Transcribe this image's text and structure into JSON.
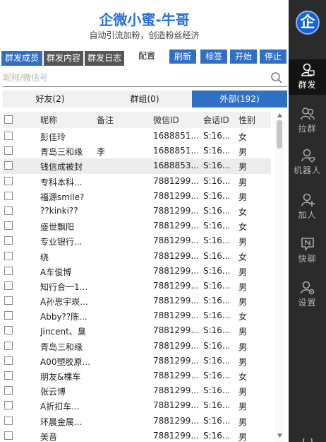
{
  "header": {
    "title": "企微小蜜-牛哥",
    "subtitle": "自动引流加粉，创造粉丝经济"
  },
  "toolbar": {
    "tabs": [
      "群发成员",
      "群发内容",
      "群发日志"
    ],
    "config_label": "配置",
    "buttons": [
      "刷新",
      "标签",
      "开始",
      "停止"
    ]
  },
  "search": {
    "placeholder": "昵称/微信号"
  },
  "segment": [
    "好友(2)",
    "群组(0)",
    "外部(192)"
  ],
  "table": {
    "columns": [
      "昵称",
      "备注",
      "微信ID",
      "会话ID",
      "性别"
    ],
    "rows": [
      {
        "nick": "彭佳玲",
        "remark": "",
        "wxid": "1688851...",
        "sid": "S:16...",
        "sex": "女"
      },
      {
        "nick": "青岛三和缘",
        "remark": "李",
        "wxid": "1688851...",
        "sid": "S:16...",
        "sex": "男"
      },
      {
        "nick": "钱信成被封",
        "remark": "",
        "wxid": "1688853...",
        "sid": "S:16...",
        "sex": "男"
      },
      {
        "nick": "专科本科...",
        "remark": "",
        "wxid": "7881299...",
        "sid": "S:16...",
        "sex": "男"
      },
      {
        "nick": "福源smile?",
        "remark": "",
        "wxid": "7881299...",
        "sid": "S:16...",
        "sex": "男"
      },
      {
        "nick": "??kinki??",
        "remark": "",
        "wxid": "7881299...",
        "sid": "S:16...",
        "sex": "女"
      },
      {
        "nick": "盛世飘阳",
        "remark": "",
        "wxid": "7881299...",
        "sid": "S:16...",
        "sex": "女"
      },
      {
        "nick": "专业银行...",
        "remark": "",
        "wxid": "7881299...",
        "sid": "S:16...",
        "sex": "男"
      },
      {
        "nick": "绕",
        "remark": "",
        "wxid": "7881299...",
        "sid": "S:16...",
        "sex": "女"
      },
      {
        "nick": "A车俊博",
        "remark": "",
        "wxid": "7881299...",
        "sid": "S:16...",
        "sex": "男"
      },
      {
        "nick": "知行合一1...",
        "remark": "",
        "wxid": "7881299...",
        "sid": "S:16...",
        "sex": "男"
      },
      {
        "nick": "A孙思宇崁...",
        "remark": "",
        "wxid": "7881299...",
        "sid": "S:16...",
        "sex": "男"
      },
      {
        "nick": "Abby??陈...",
        "remark": "",
        "wxid": "7881299...",
        "sid": "S:16...",
        "sex": "女"
      },
      {
        "nick": "Jincent、臭",
        "remark": "",
        "wxid": "7881299...",
        "sid": "S:16...",
        "sex": "男"
      },
      {
        "nick": "青岛三和缘",
        "remark": "",
        "wxid": "7881299...",
        "sid": "S:16...",
        "sex": "男"
      },
      {
        "nick": "A00塑胶原...",
        "remark": "",
        "wxid": "7881299...",
        "sid": "S:16...",
        "sex": "男"
      },
      {
        "nick": "朋友&棵车",
        "remark": "",
        "wxid": "7881299...",
        "sid": "S:16...",
        "sex": "女"
      },
      {
        "nick": "张云博",
        "remark": "",
        "wxid": "7881299...",
        "sid": "S:16...",
        "sex": "男"
      },
      {
        "nick": "A折扣车...",
        "remark": "",
        "wxid": "7881299...",
        "sid": "S:16...",
        "sex": "男"
      },
      {
        "nick": "环晨金属...",
        "remark": "",
        "wxid": "7881299...",
        "sid": "S:16...",
        "sex": "男"
      },
      {
        "nick": "美音",
        "remark": "",
        "wxid": "7881299...",
        "sid": "S:16...",
        "sex": "男"
      }
    ]
  },
  "sidebar": {
    "logo": "企",
    "items": [
      {
        "label": "群发",
        "icon": "mass-send-icon"
      },
      {
        "label": "拉群",
        "icon": "group-icon"
      },
      {
        "label": "机器人",
        "icon": "robot-heart-icon"
      },
      {
        "label": "加人",
        "icon": "add-person-icon"
      },
      {
        "label": "快聊",
        "icon": "quick-chat-icon"
      },
      {
        "label": "设置",
        "icon": "settings-icon"
      }
    ]
  }
}
